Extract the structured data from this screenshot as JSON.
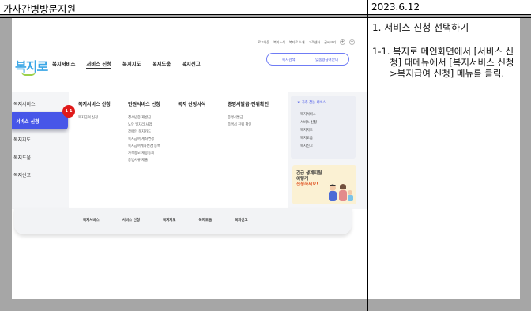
{
  "doc": {
    "title": "가사간병방문지원",
    "date": "2023.6.12"
  },
  "description": {
    "step": "1. 서비스 신청 선택하기",
    "text": "1-1. 복지로 메인화면에서 [서비스 신청] 대메뉴에서 [복지서비스 신청>복지급여 신청] 메뉴를 클릭."
  },
  "screenshot": {
    "util_links": [
      "로그아웃",
      "복지소식",
      "복지로 소개",
      "고객센터",
      "글씨크기"
    ],
    "logo": "복지로",
    "nav": [
      "복지서비스",
      "서비스 신청",
      "복지지도",
      "복지도움",
      "복지신고"
    ],
    "search_pill": {
      "left": "복지검색",
      "right": "맞춤형급여안내"
    },
    "side_menu": [
      "복지서비스",
      "서비스 신청",
      "복지지도",
      "복지도움",
      "복지신고"
    ],
    "badge": "1-1",
    "mega_columns": [
      {
        "heading": "복지서비스 신청",
        "items": [
          "복지급여 신청"
        ]
      },
      {
        "heading": "민원서비스 신청",
        "items": [
          "청소년증 재발급",
          "노인 일자리 사업",
          "장애인 복지카드",
          "복지급여 계좌변경",
          "복지급여계좌변경 등록",
          "가족향보 재공동의",
          "증빙서류 제출"
        ]
      },
      {
        "heading": "복지 신청서식",
        "items": []
      },
      {
        "heading": "증명서발급·진위확인",
        "items": [
          "증명서발급",
          "증명서 진위 확인"
        ]
      }
    ],
    "quick": {
      "title": "자주 찾는 서비스",
      "items": [
        "복지서비스",
        "서비스 신청",
        "복지지도",
        "복지도움",
        "복지신고"
      ]
    },
    "promo": {
      "line1": "긴급 생계지원",
      "line2": "이렇게",
      "line3": "신청하세요!"
    },
    "footer_nav": [
      "복지서비스",
      "서비스 신청",
      "복지지도",
      "복지도움",
      "복지신고"
    ]
  }
}
